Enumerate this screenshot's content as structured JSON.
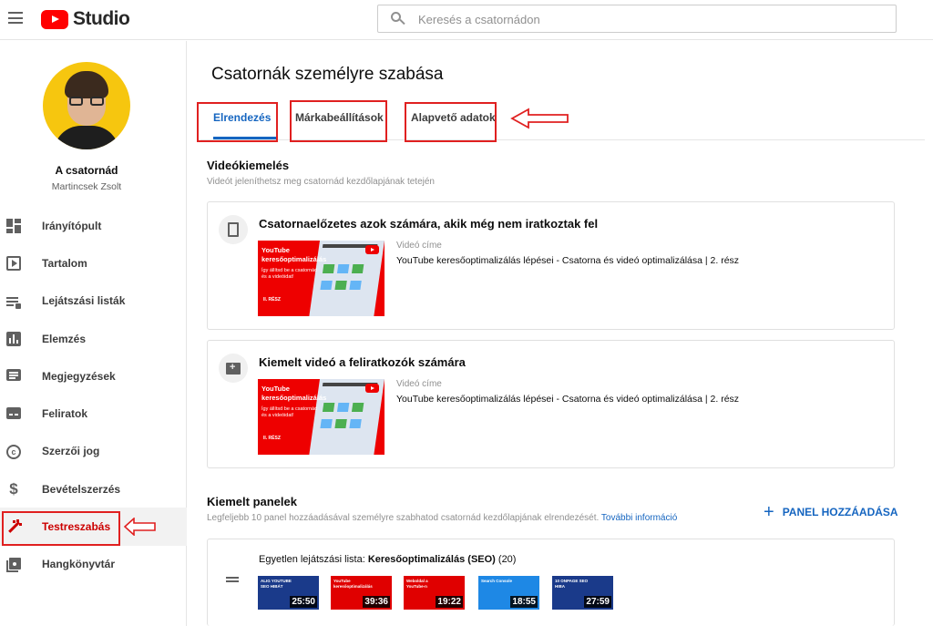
{
  "app": {
    "logo_text": "Studio",
    "search_placeholder": "Keresés a csatornádon"
  },
  "sidebar": {
    "channel_label": "A csatornád",
    "channel_owner": "Martincsek Zsolt",
    "items": [
      {
        "label": "Irányítópult",
        "icon": "dashboard-icon"
      },
      {
        "label": "Tartalom",
        "icon": "content-icon"
      },
      {
        "label": "Lejátszási listák",
        "icon": "playlists-icon"
      },
      {
        "label": "Elemzés",
        "icon": "analytics-icon"
      },
      {
        "label": "Megjegyzések",
        "icon": "comments-icon"
      },
      {
        "label": "Feliratok",
        "icon": "subtitles-icon"
      },
      {
        "label": "Szerzői jog",
        "icon": "copyright-icon"
      },
      {
        "label": "Bevételszerzés",
        "icon": "dollar-icon"
      },
      {
        "label": "Testreszabás",
        "icon": "magic-wand-icon",
        "active": true
      },
      {
        "label": "Hangkönyvtár",
        "icon": "audio-library-icon"
      }
    ]
  },
  "main": {
    "page_title": "Csatornák személyre szabása",
    "tabs": [
      {
        "label": "Elrendezés",
        "active": true
      },
      {
        "label": "Márkabeállítások"
      },
      {
        "label": "Alapvető adatok"
      }
    ],
    "video_spotlight": {
      "title": "Videókiemelés",
      "subtitle": "Videót jeleníthetsz meg csatornád kezdőlapjának tetején",
      "cards": [
        {
          "title": "Csatornaelőzetes azok számára, akik még nem iratkoztak fel",
          "video_label": "Videó címe",
          "video_title": "YouTube keresőoptimalizálás lépései - Csatorna és videó optimalizálása | 2. rész",
          "thumb_title": "YouTube keresőoptimalizálás",
          "thumb_sub": "Így állítsd be a csatornád és a videóidat!",
          "thumb_part": "II. RÉSZ"
        },
        {
          "title": "Kiemelt videó a feliratkozók számára",
          "video_label": "Videó címe",
          "video_title": "YouTube keresőoptimalizálás lépései - Csatorna és videó optimalizálása | 2. rész",
          "thumb_title": "YouTube keresőoptimalizálás",
          "thumb_sub": "Így állítsd be a csatornád és a videóidat!",
          "thumb_part": "II. RÉSZ"
        }
      ]
    },
    "featured_sections": {
      "title": "Kiemelt panelek",
      "subtitle": "Legfeljebb 10 panel hozzáadásával személyre szabhatod csatornád kezdőlapjának elrendezését.",
      "more_info": "További információ",
      "add_button": "PANEL HOZZÁADÁSA",
      "playlist_prefix": "Egyetlen lejátszási lista:",
      "playlist_name": "Keresőoptimalizálás (SEO)",
      "playlist_count": "(20)",
      "thumbnails": [
        {
          "duration": "25:50",
          "bg": "#1a3a8a"
        },
        {
          "duration": "39:36",
          "bg": "#e00000"
        },
        {
          "duration": "19:22",
          "bg": "#e00000"
        },
        {
          "duration": "18:55",
          "bg": "#1e88e5"
        },
        {
          "duration": "27:59",
          "bg": "#1a3a8a"
        }
      ]
    }
  },
  "colors": {
    "accent": "#1565c0",
    "brand_red": "#ff0000",
    "annotation_red": "#e02020"
  }
}
